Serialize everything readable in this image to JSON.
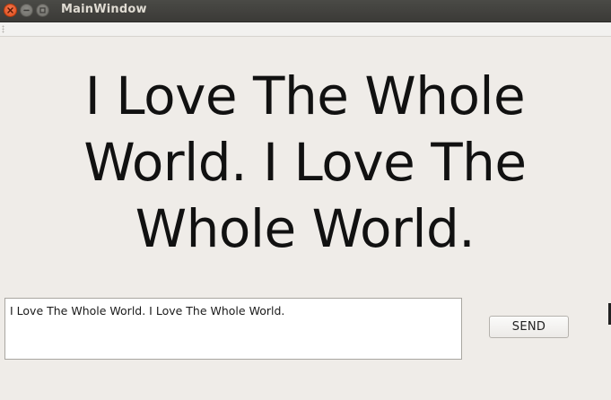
{
  "window": {
    "title": "MainWindow"
  },
  "titlebar_buttons": {
    "close": "close-icon",
    "minimize": "minimize-icon",
    "maximize": "maximize-icon"
  },
  "display": {
    "text": "I Love The Whole World. I Love The Whole World."
  },
  "input": {
    "value": "I Love The Whole World. I Love The Whole World."
  },
  "send_button": {
    "label": "SEND"
  }
}
